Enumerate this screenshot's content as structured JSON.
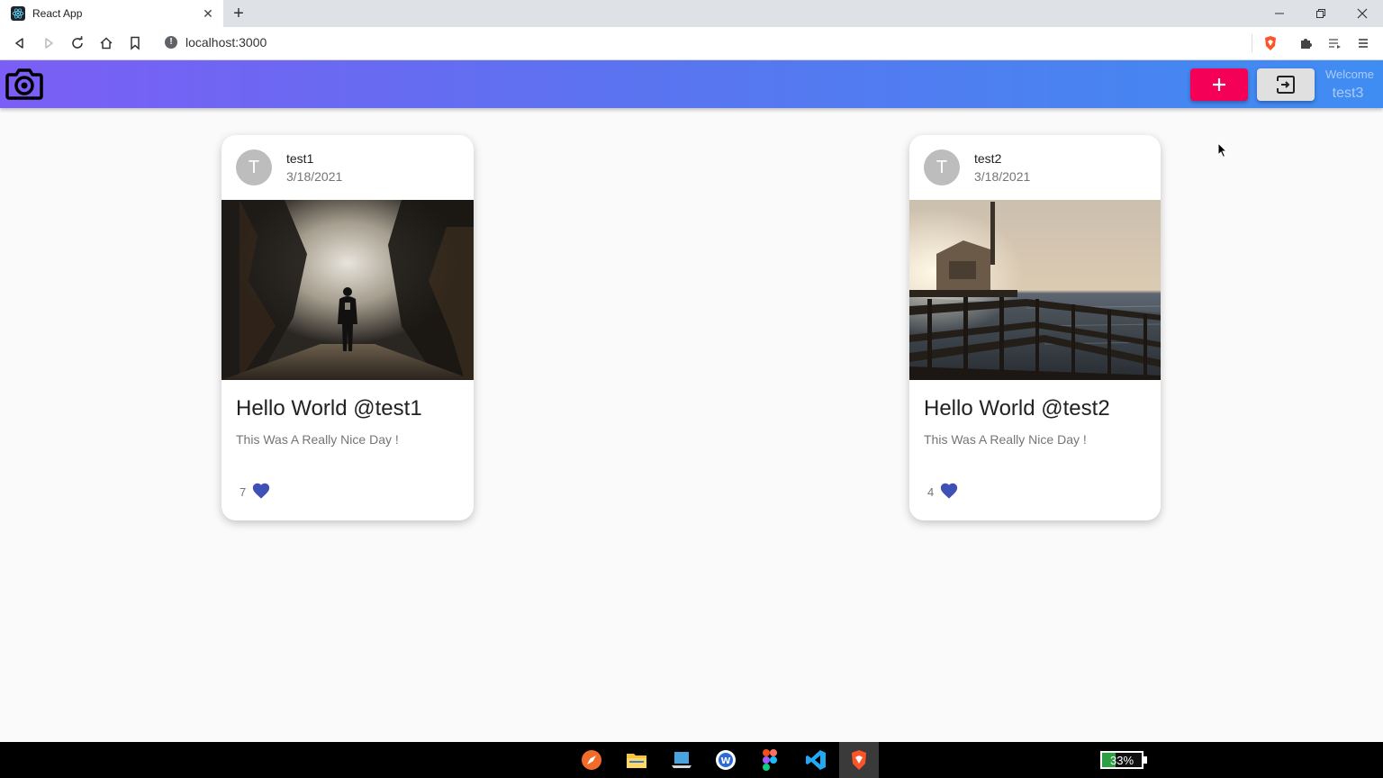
{
  "browser": {
    "tab_title": "React App",
    "tab_close": "✕",
    "new_tab": "+",
    "url": "localhost:3000"
  },
  "app": {
    "logo_icon": "camera-icon",
    "add_icon": "plus-icon",
    "logout_icon": "exit-to-app-icon",
    "welcome_label": "Welcome",
    "username": "test3",
    "colors": {
      "appbar_start": "#7b5ef5",
      "appbar_end": "#3f8df2",
      "add_button": "#f50057",
      "heart": "#3f51b5"
    }
  },
  "posts": [
    {
      "avatar_letter": "T",
      "author": "test1",
      "date": "3/18/2021",
      "title": "Hello World @test1",
      "body": "This Was A Really Nice Day !",
      "likes": "7"
    },
    {
      "avatar_letter": "T",
      "author": "test2",
      "date": "3/18/2021",
      "title": "Hello World @test2",
      "body": "This Was A Really Nice Day !",
      "likes": "4"
    }
  ],
  "taskbar": {
    "battery_text": "33%",
    "battery_level": 0.33
  }
}
